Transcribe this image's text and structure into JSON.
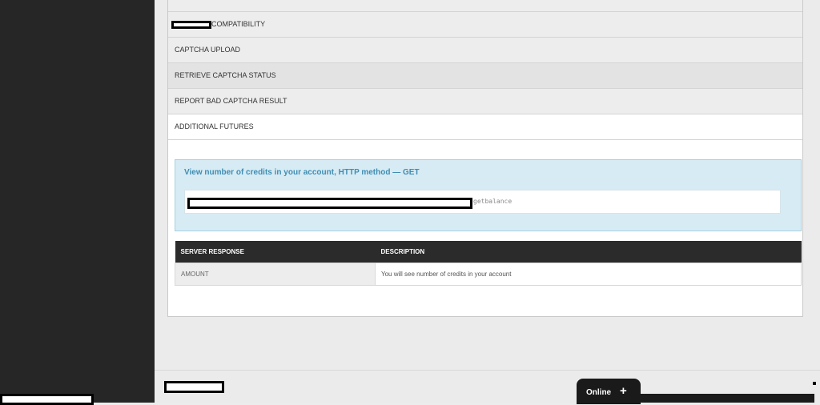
{
  "menu": {
    "items": [
      {
        "label": "COMPATIBILITY"
      },
      {
        "label": "CAPTCHA UPLOAD"
      },
      {
        "label": "RETRIEVE CAPTCHA STATUS"
      },
      {
        "label": "REPORT BAD CAPTCHA RESULT"
      },
      {
        "label": "ADDITIONAL FUTURES"
      }
    ]
  },
  "info": {
    "title": "View number of credits in your account, HTTP method — GET",
    "code_suffix": "getbalance"
  },
  "table": {
    "headers": [
      "SERVER RESPONSE",
      "DESCRIPTION"
    ],
    "rows": [
      {
        "key": "AMOUNT",
        "value": "You will see number of credits in your account"
      }
    ]
  },
  "chat": {
    "label": "Online"
  }
}
